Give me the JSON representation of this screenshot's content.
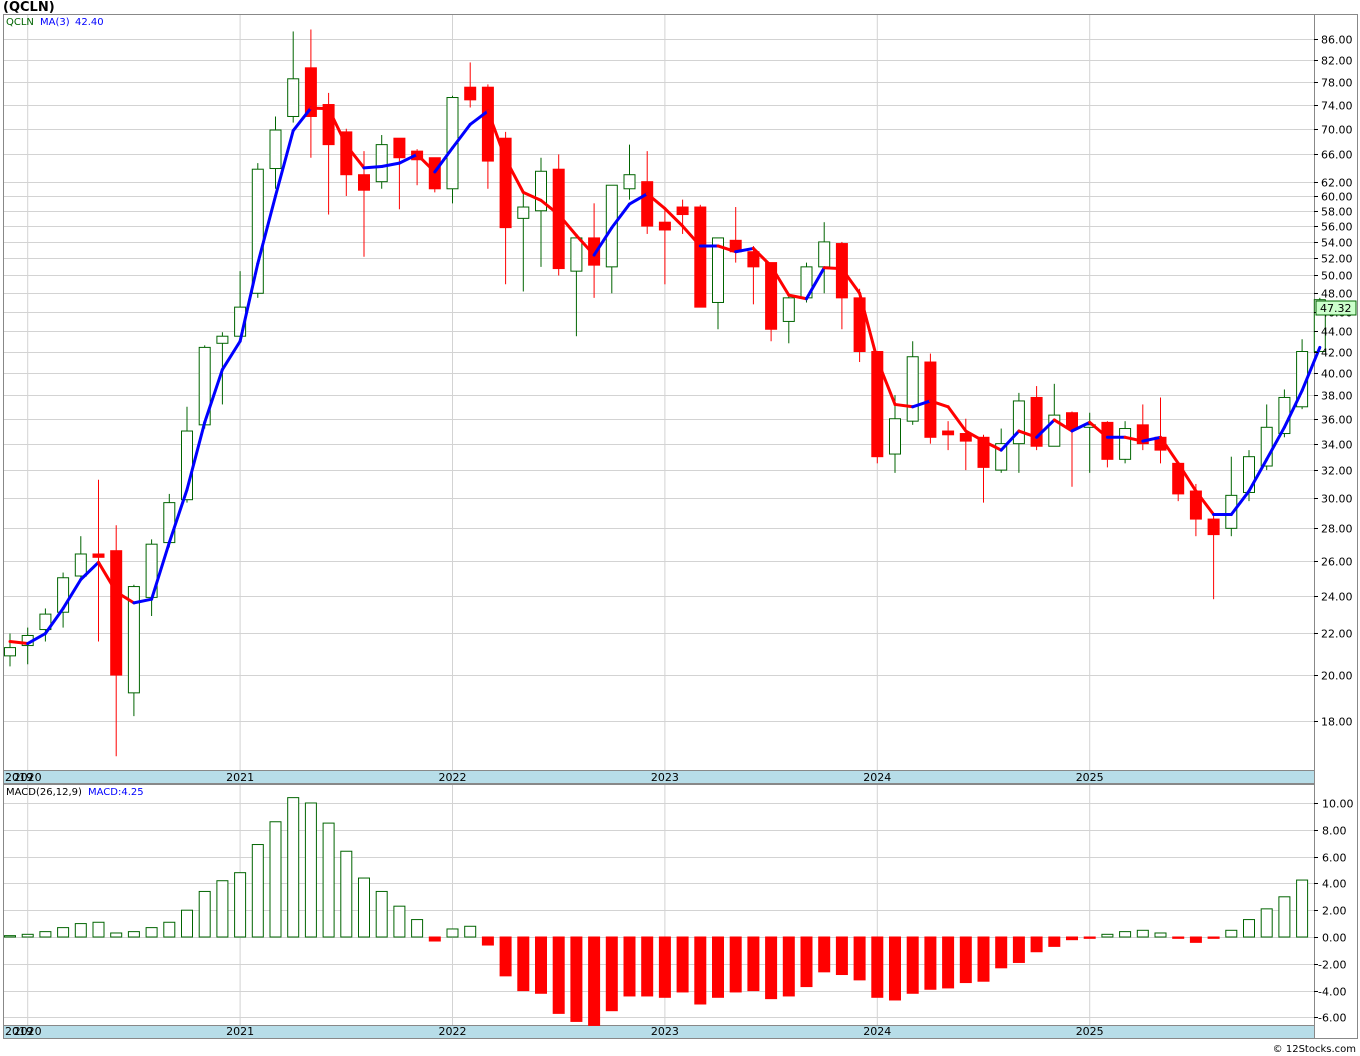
{
  "title": "(QCLN)",
  "price_panel": {
    "symbol": "QCLN",
    "ma_label": "MA(3)",
    "ma_value": "42.40",
    "last_price": "47.32"
  },
  "macd_panel": {
    "label": "MACD(26,12,9)",
    "value_label": "MACD:4.25"
  },
  "watermark": "© 12Stocks.com",
  "colors": {
    "up": "#006400",
    "down": "#ff0000",
    "ma_up": "#0000ff",
    "ma_down": "#ff0000",
    "axis_band": "#b7dde8",
    "grid": "#d3d3d3",
    "last_price_bg": "#ccffcc"
  },
  "chart_data": [
    {
      "type": "candlestick",
      "title": "(QCLN)",
      "scale": "log",
      "ylim": [
        16.6,
        91
      ],
      "x_axis_years": [
        "2019",
        "2020",
        "2021",
        "2022",
        "2023",
        "2024",
        "2025"
      ],
      "y_ticks": [
        "18.00",
        "20.00",
        "22.00",
        "24.00",
        "26.00",
        "28.00",
        "30.00",
        "32.00",
        "34.00",
        "36.00",
        "38.00",
        "40.00",
        "42.00",
        "44.00",
        "46.00",
        "48.00",
        "50.00",
        "52.00",
        "54.00",
        "56.00",
        "58.00",
        "60.00",
        "62.00",
        "66.00",
        "70.00",
        "74.00",
        "78.00",
        "82.00",
        "86.00"
      ],
      "grid": true,
      "candles": [
        {
          "d": "2019-12",
          "o": 20.9,
          "h": 22.0,
          "l": 20.4,
          "c": 21.3
        },
        {
          "d": "2020-01",
          "o": 21.4,
          "h": 22.3,
          "l": 20.5,
          "c": 21.9
        },
        {
          "d": "2020-02",
          "o": 22.2,
          "h": 23.3,
          "l": 21.6,
          "c": 23.0
        },
        {
          "d": "2020-03",
          "o": 23.1,
          "h": 25.3,
          "l": 22.3,
          "c": 25.0
        },
        {
          "d": "2020-04",
          "o": 25.1,
          "h": 27.5,
          "l": 24.8,
          "c": 26.4
        },
        {
          "d": "2020-05",
          "o": 26.4,
          "h": 31.3,
          "l": 21.6,
          "c": 26.2
        },
        {
          "d": "2020-06",
          "o": 26.6,
          "h": 28.2,
          "l": 16.6,
          "c": 20.0
        },
        {
          "d": "2020-07",
          "o": 19.2,
          "h": 24.6,
          "l": 18.2,
          "c": 24.5
        },
        {
          "d": "2020-08",
          "o": 23.9,
          "h": 27.3,
          "l": 22.9,
          "c": 27.0
        },
        {
          "d": "2020-09",
          "o": 27.1,
          "h": 30.3,
          "l": 26.8,
          "c": 29.7
        },
        {
          "d": "2020-10",
          "o": 29.9,
          "h": 37.0,
          "l": 29.7,
          "c": 35.0
        },
        {
          "d": "2020-11",
          "o": 35.5,
          "h": 42.6,
          "l": 35.2,
          "c": 42.4
        },
        {
          "d": "2020-12",
          "o": 42.8,
          "h": 43.9,
          "l": 37.2,
          "c": 43.5
        },
        {
          "d": "2021-01",
          "o": 43.5,
          "h": 50.5,
          "l": 43.0,
          "c": 46.5
        },
        {
          "d": "2021-02",
          "o": 48.0,
          "h": 64.7,
          "l": 47.5,
          "c": 63.8
        },
        {
          "d": "2021-03",
          "o": 63.9,
          "h": 72.0,
          "l": 61.0,
          "c": 69.8
        },
        {
          "d": "2021-04",
          "o": 72.0,
          "h": 87.5,
          "l": 71.0,
          "c": 78.5
        },
        {
          "d": "2021-05",
          "o": 80.5,
          "h": 87.9,
          "l": 65.5,
          "c": 72.0
        },
        {
          "d": "2021-06",
          "o": 74.0,
          "h": 76.0,
          "l": 57.5,
          "c": 67.5
        },
        {
          "d": "2021-07",
          "o": 69.5,
          "h": 70.0,
          "l": 60.0,
          "c": 63.0
        },
        {
          "d": "2021-08",
          "o": 63.0,
          "h": 66.5,
          "l": 52.2,
          "c": 60.8
        },
        {
          "d": "2021-09",
          "o": 62.0,
          "h": 69.0,
          "l": 61.0,
          "c": 67.5
        },
        {
          "d": "2021-10",
          "o": 68.5,
          "h": 68.5,
          "l": 58.2,
          "c": 65.5
        },
        {
          "d": "2021-11",
          "o": 66.5,
          "h": 66.8,
          "l": 61.5,
          "c": 65.2
        },
        {
          "d": "2021-12",
          "o": 65.5,
          "h": 65.5,
          "l": 60.5,
          "c": 61.0
        },
        {
          "d": "2022-01",
          "o": 61.0,
          "h": 75.5,
          "l": 59.0,
          "c": 75.2
        },
        {
          "d": "2022-02",
          "o": 77.0,
          "h": 81.5,
          "l": 73.5,
          "c": 74.8
        },
        {
          "d": "2022-03",
          "o": 77.0,
          "h": 77.5,
          "l": 61.0,
          "c": 65.0
        },
        {
          "d": "2022-04",
          "o": 68.5,
          "h": 69.5,
          "l": 49.0,
          "c": 55.8
        },
        {
          "d": "2022-05",
          "o": 57.0,
          "h": 60.5,
          "l": 48.2,
          "c": 58.5
        },
        {
          "d": "2022-06",
          "o": 58.0,
          "h": 65.5,
          "l": 51.0,
          "c": 63.5
        },
        {
          "d": "2022-07",
          "o": 63.8,
          "h": 66.0,
          "l": 50.0,
          "c": 50.8
        },
        {
          "d": "2022-08",
          "o": 50.5,
          "h": 54.5,
          "l": 43.5,
          "c": 54.5
        },
        {
          "d": "2022-09",
          "o": 54.5,
          "h": 59.0,
          "l": 47.5,
          "c": 51.2
        },
        {
          "d": "2022-10",
          "o": 51.0,
          "h": 61.5,
          "l": 48.0,
          "c": 61.5
        },
        {
          "d": "2022-11",
          "o": 61.0,
          "h": 67.5,
          "l": 59.5,
          "c": 63.0
        },
        {
          "d": "2022-12",
          "o": 62.0,
          "h": 66.5,
          "l": 55.0,
          "c": 56.0
        },
        {
          "d": "2023-01",
          "o": 56.5,
          "h": 58.5,
          "l": 49.0,
          "c": 55.5
        },
        {
          "d": "2023-02",
          "o": 58.5,
          "h": 59.5,
          "l": 55.0,
          "c": 57.5
        },
        {
          "d": "2023-03",
          "o": 58.5,
          "h": 58.8,
          "l": 46.5,
          "c": 46.5
        },
        {
          "d": "2023-04",
          "o": 47.0,
          "h": 54.5,
          "l": 44.2,
          "c": 54.5
        },
        {
          "d": "2023-05",
          "o": 54.2,
          "h": 58.5,
          "l": 51.5,
          "c": 52.8
        },
        {
          "d": "2023-06",
          "o": 52.8,
          "h": 53.5,
          "l": 46.8,
          "c": 51.0
        },
        {
          "d": "2023-07",
          "o": 51.5,
          "h": 51.5,
          "l": 43.0,
          "c": 44.2
        },
        {
          "d": "2023-08",
          "o": 45.0,
          "h": 48.0,
          "l": 42.8,
          "c": 47.5
        },
        {
          "d": "2023-09",
          "o": 47.5,
          "h": 51.5,
          "l": 47.0,
          "c": 51.0
        },
        {
          "d": "2023-10",
          "o": 51.0,
          "h": 56.5,
          "l": 48.0,
          "c": 54.0
        },
        {
          "d": "2023-11",
          "o": 53.8,
          "h": 54.0,
          "l": 44.2,
          "c": 47.5
        },
        {
          "d": "2023-12",
          "o": 47.5,
          "h": 48.5,
          "l": 41.0,
          "c": 42.0
        },
        {
          "d": "2024-01",
          "o": 42.0,
          "h": 42.0,
          "l": 32.5,
          "c": 33.0
        },
        {
          "d": "2024-02",
          "o": 33.2,
          "h": 38.0,
          "l": 31.8,
          "c": 36.0
        },
        {
          "d": "2024-03",
          "o": 35.8,
          "h": 43.0,
          "l": 35.5,
          "c": 41.5
        },
        {
          "d": "2024-04",
          "o": 41.0,
          "h": 41.8,
          "l": 34.0,
          "c": 34.5
        },
        {
          "d": "2024-05",
          "o": 35.0,
          "h": 35.8,
          "l": 33.5,
          "c": 34.7
        },
        {
          "d": "2024-06",
          "o": 34.8,
          "h": 36.0,
          "l": 32.0,
          "c": 34.2
        },
        {
          "d": "2024-07",
          "o": 34.5,
          "h": 34.7,
          "l": 29.7,
          "c": 32.2
        },
        {
          "d": "2024-08",
          "o": 32.0,
          "h": 35.2,
          "l": 31.8,
          "c": 34.0
        },
        {
          "d": "2024-09",
          "o": 34.0,
          "h": 38.2,
          "l": 31.8,
          "c": 37.5
        },
        {
          "d": "2024-10",
          "o": 37.8,
          "h": 38.8,
          "l": 33.5,
          "c": 33.8
        },
        {
          "d": "2024-11",
          "o": 33.8,
          "h": 39.0,
          "l": 33.8,
          "c": 36.3
        },
        {
          "d": "2024-12",
          "o": 36.5,
          "h": 36.6,
          "l": 30.8,
          "c": 35.2
        },
        {
          "d": "2025-01",
          "o": 35.3,
          "h": 36.5,
          "l": 31.8,
          "c": 35.5
        },
        {
          "d": "2025-02",
          "o": 35.7,
          "h": 35.8,
          "l": 32.2,
          "c": 32.8
        },
        {
          "d": "2025-03",
          "o": 32.8,
          "h": 35.8,
          "l": 32.5,
          "c": 35.2
        },
        {
          "d": "2025-04",
          "o": 35.5,
          "h": 37.2,
          "l": 33.5,
          "c": 34.0
        },
        {
          "d": "2025-05",
          "o": 34.5,
          "h": 37.8,
          "l": 32.5,
          "c": 33.5
        },
        {
          "d": "2025-06",
          "o": 32.5,
          "h": 32.5,
          "l": 29.8,
          "c": 30.3
        },
        {
          "d": "2025-07",
          "o": 30.5,
          "h": 31.0,
          "l": 27.5,
          "c": 28.6
        },
        {
          "d": "2025-08",
          "o": 28.6,
          "h": 29.0,
          "l": 23.8,
          "c": 27.6
        },
        {
          "d": "2025-09",
          "o": 28.0,
          "h": 33.0,
          "l": 27.5,
          "c": 30.2
        },
        {
          "d": "2025-10",
          "o": 30.4,
          "h": 33.5,
          "l": 29.8,
          "c": 33.0
        },
        {
          "d": "2025-11",
          "o": 32.3,
          "h": 37.2,
          "l": 32.0,
          "c": 35.3
        },
        {
          "d": "2025-12",
          "o": 34.8,
          "h": 38.5,
          "l": 34.5,
          "c": 37.8
        },
        {
          "d": "2026-01",
          "o": 37.0,
          "h": 43.2,
          "l": 36.8,
          "c": 42.0
        },
        {
          "d": "2026-02",
          "o": 42.0,
          "h": 47.5,
          "l": 42.0,
          "c": 47.3
        }
      ],
      "ma": {
        "name": "MA(3)",
        "values": [
          21.6,
          21.5,
          22.0,
          23.3,
          24.9,
          25.9,
          24.2,
          23.6,
          23.8,
          27.1,
          30.6,
          35.7,
          40.3,
          43.0,
          51.4,
          60.0,
          69.7,
          73.4,
          73.3,
          67.4,
          64.0,
          64.2,
          64.7,
          66.0,
          63.4,
          67.0,
          70.7,
          72.9,
          65.3,
          60.5,
          59.4,
          57.5,
          54.8,
          52.4,
          55.8,
          58.9,
          60.3,
          58.3,
          56.0,
          53.5,
          53.5,
          52.8,
          53.2,
          51.1,
          47.8,
          47.4,
          50.9,
          50.8,
          48.0,
          41.2,
          37.2,
          37.0,
          37.5,
          37.0,
          35.0,
          34.2,
          33.5,
          35.0,
          34.5,
          35.9,
          35.0,
          35.7,
          34.5,
          34.5,
          34.2,
          34.5,
          32.5,
          30.5,
          28.9,
          28.9,
          30.5,
          32.8,
          35.3,
          38.4,
          42.4
        ]
      },
      "last_price_label": "47.32"
    },
    {
      "type": "bar",
      "title": "MACD(26,12,9)",
      "ylim": [
        -6.6,
        10.8
      ],
      "y_ticks": [
        "10.00",
        "8.00",
        "6.00",
        "4.00",
        "2.00",
        "0.00",
        "-2.00",
        "-4.00",
        "-6.00"
      ],
      "values": [
        0.1,
        0.2,
        0.4,
        0.7,
        1.0,
        1.1,
        0.3,
        0.4,
        0.7,
        1.1,
        2.0,
        3.4,
        4.2,
        4.8,
        6.9,
        8.6,
        10.4,
        10.0,
        8.5,
        6.4,
        4.4,
        3.4,
        2.3,
        1.3,
        -0.3,
        0.6,
        0.8,
        -0.6,
        -2.9,
        -4.0,
        -4.2,
        -5.7,
        -6.3,
        -6.6,
        -5.5,
        -4.4,
        -4.4,
        -4.5,
        -4.1,
        -5.0,
        -4.5,
        -4.1,
        -4.0,
        -4.6,
        -4.4,
        -3.7,
        -2.6,
        -2.8,
        -3.2,
        -4.5,
        -4.7,
        -4.2,
        -3.9,
        -3.8,
        -3.4,
        -3.3,
        -2.3,
        -1.9,
        -1.1,
        -0.7,
        -0.2,
        -0.1,
        0.2,
        0.4,
        0.5,
        0.3,
        -0.1,
        -0.4,
        -0.1,
        0.5,
        1.3,
        2.1,
        3.0,
        4.25
      ]
    }
  ]
}
